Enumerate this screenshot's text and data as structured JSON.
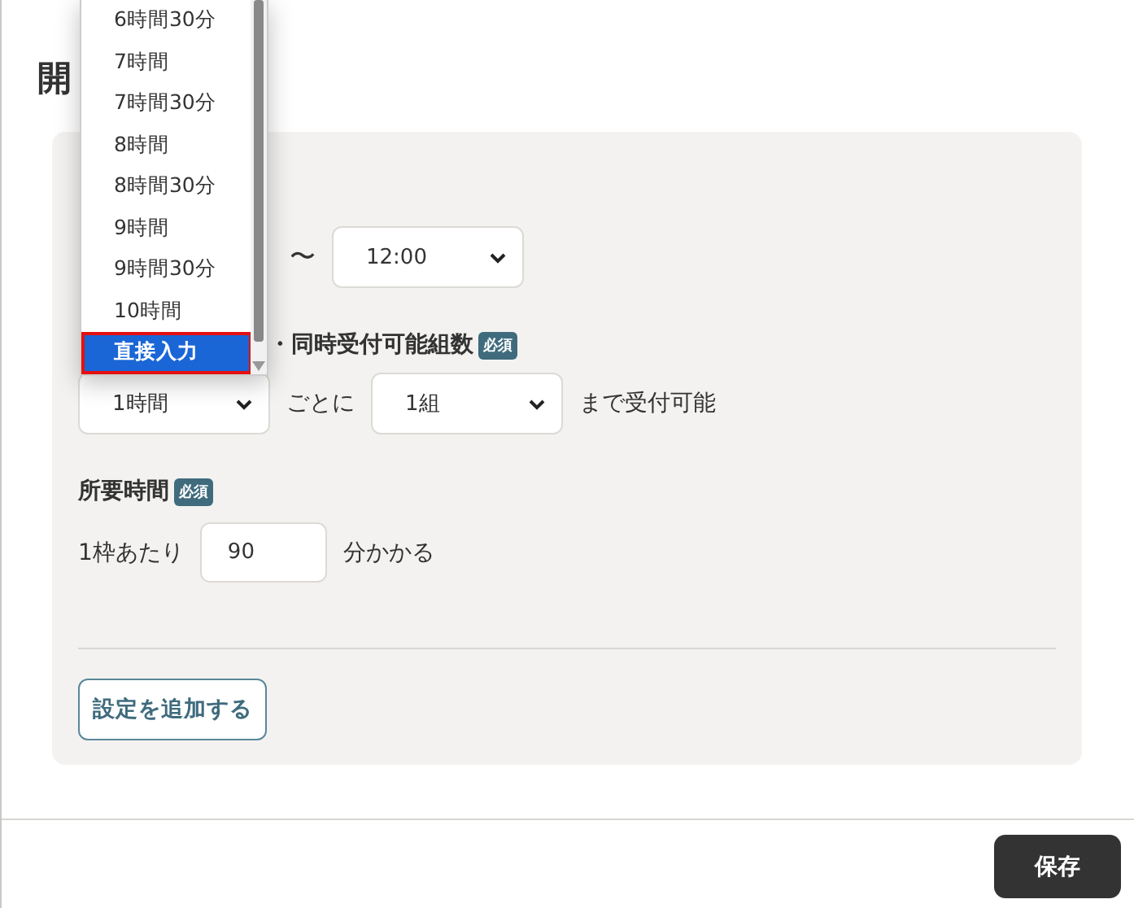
{
  "heading": "開",
  "dropdown": {
    "options": [
      {
        "label": "6時間30分",
        "selected": false
      },
      {
        "label": "7時間",
        "selected": false
      },
      {
        "label": "7時間30分",
        "selected": false
      },
      {
        "label": "8時間",
        "selected": false
      },
      {
        "label": "8時間30分",
        "selected": false
      },
      {
        "label": "9時間",
        "selected": false
      },
      {
        "label": "9時間30分",
        "selected": false
      },
      {
        "label": "10時間",
        "selected": false
      },
      {
        "label": "直接入力",
        "selected": true
      }
    ]
  },
  "time_range": {
    "separator": "〜",
    "end_select": {
      "value": "12:00"
    }
  },
  "capacity": {
    "label": "・同時受付可能組数",
    "badge": "必須",
    "interval_select": {
      "value": "1時間"
    },
    "text_after_interval": "ごとに",
    "count_select": {
      "value": "1組"
    },
    "text_after_count": "まで受付可能"
  },
  "duration": {
    "label": "所要時間",
    "badge": "必須",
    "prefix": "1枠あたり",
    "input": {
      "value": "90"
    },
    "suffix": "分かかる"
  },
  "add_button": "設定を追加する",
  "save_button": "保存"
}
